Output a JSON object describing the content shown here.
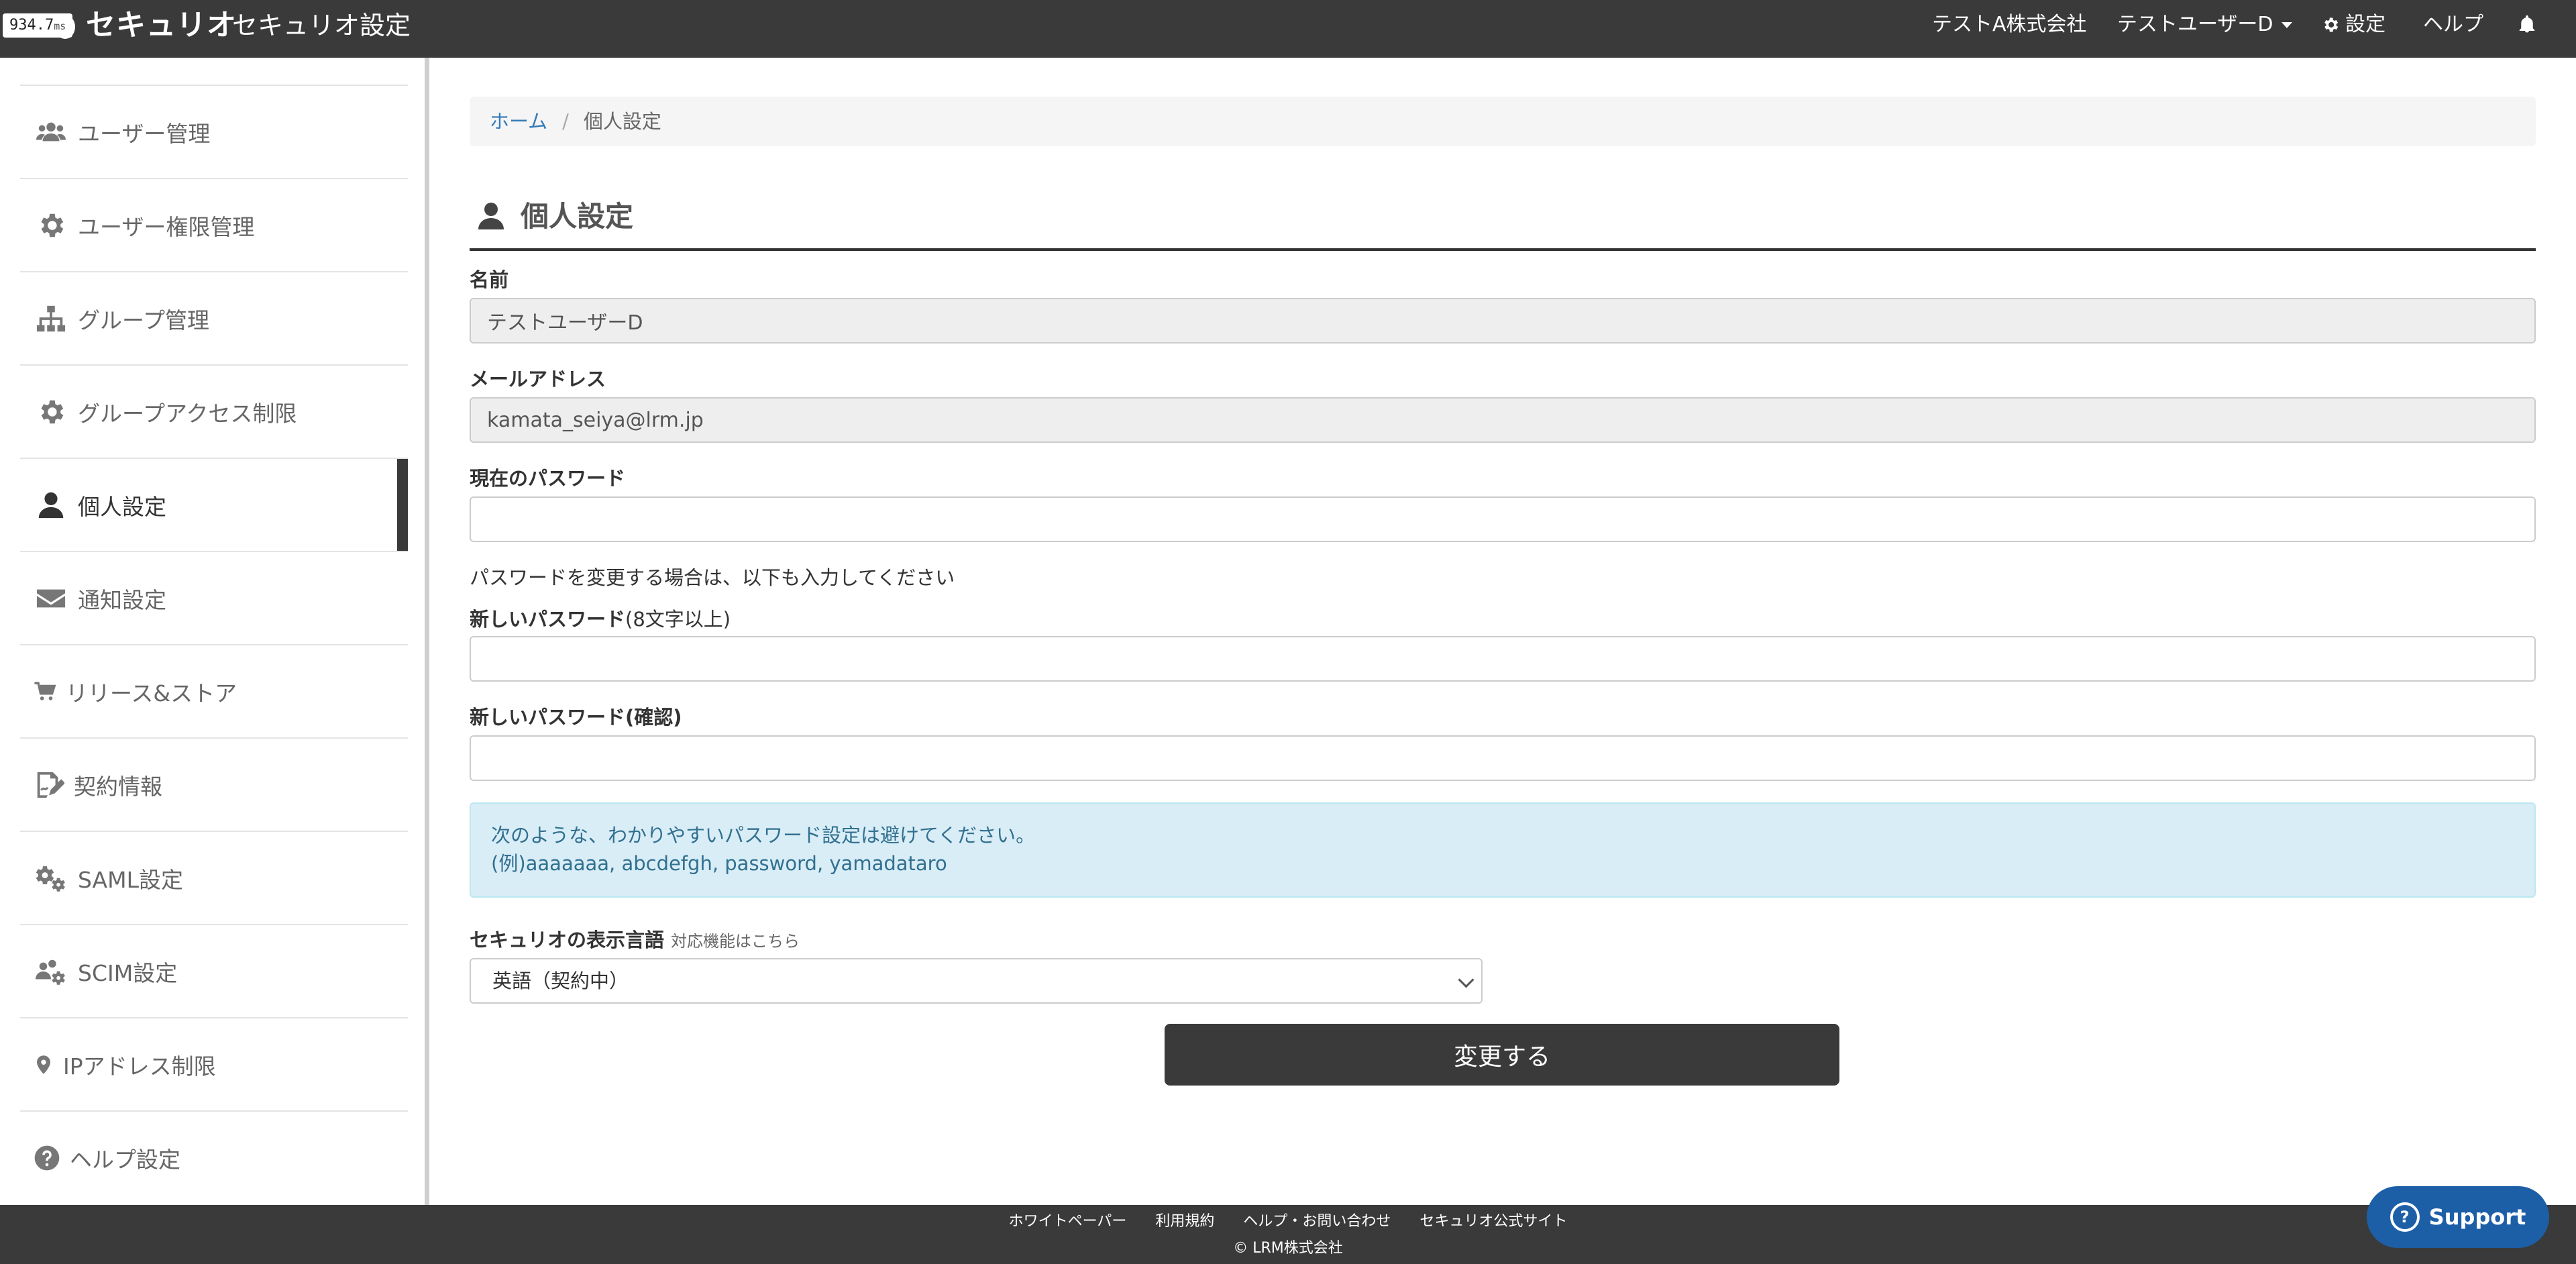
{
  "navbar": {
    "timer_value": "934.7",
    "timer_unit": "ms",
    "brand": "セキュリオ",
    "app_title": "セキュリオ設定",
    "company": "テストA株式会社",
    "user": "テストユーザーD",
    "settings": "設定",
    "help": "ヘルプ",
    "icons": {
      "settings": "gear-icon",
      "notifications": "bell-icon"
    }
  },
  "sidebar": {
    "items": [
      {
        "label": "ユーザー管理",
        "icon": "users-icon"
      },
      {
        "label": "ユーザー権限管理",
        "icon": "gear-icon"
      },
      {
        "label": "グループ管理",
        "icon": "sitemap-icon"
      },
      {
        "label": "グループアクセス制限",
        "icon": "gear-icon"
      },
      {
        "label": "個人設定",
        "icon": "user-icon",
        "active": true
      },
      {
        "label": "通知設定",
        "icon": "envelope-icon"
      },
      {
        "label": "リリース&ストア",
        "icon": "cart-icon"
      },
      {
        "label": "契約情報",
        "icon": "contract-icon"
      },
      {
        "label": "SAML設定",
        "icon": "gears-icon"
      },
      {
        "label": "SCIM設定",
        "icon": "users-gear-icon"
      },
      {
        "label": "IPアドレス制限",
        "icon": "map-marker-icon"
      },
      {
        "label": "ヘルプ設定",
        "icon": "question-circle-icon"
      }
    ]
  },
  "breadcrumb": {
    "home": "ホーム",
    "separator": "/",
    "current": "個人設定"
  },
  "page": {
    "title": "個人設定"
  },
  "form": {
    "name_label": "名前",
    "name_value": "テストユーザーD",
    "email_label": "メールアドレス",
    "email_value": "kamata_seiya@lrm.jp",
    "current_password_label": "現在のパスワード",
    "change_hint": "パスワードを変更する場合は、以下も入力してください",
    "new_password_label": "新しいパスワード",
    "new_password_note": "(8文字以上)",
    "confirm_password_label": "新しいパスワード(確認)",
    "alert_line1": "次のような、わかりやすいパスワード設定は避けてください。",
    "alert_line2": "(例)aaaaaaa, abcdefgh, password, yamadataro",
    "language_label": "セキュリオの表示言語",
    "language_link": "対応機能はこちら",
    "language_value": "英語（契約中）",
    "submit_label": "変更する"
  },
  "footer": {
    "links": [
      "ホワイトペーパー",
      "利用規約",
      "ヘルプ・お問い合わせ",
      "セキュリオ公式サイト"
    ],
    "copyright": "© LRM株式会社"
  },
  "support": {
    "label": "Support"
  },
  "colors": {
    "navbar": "#3a3a3a",
    "link": "#337ab7",
    "alert_bg": "#d9edf7",
    "support": "#1d5fa7"
  }
}
